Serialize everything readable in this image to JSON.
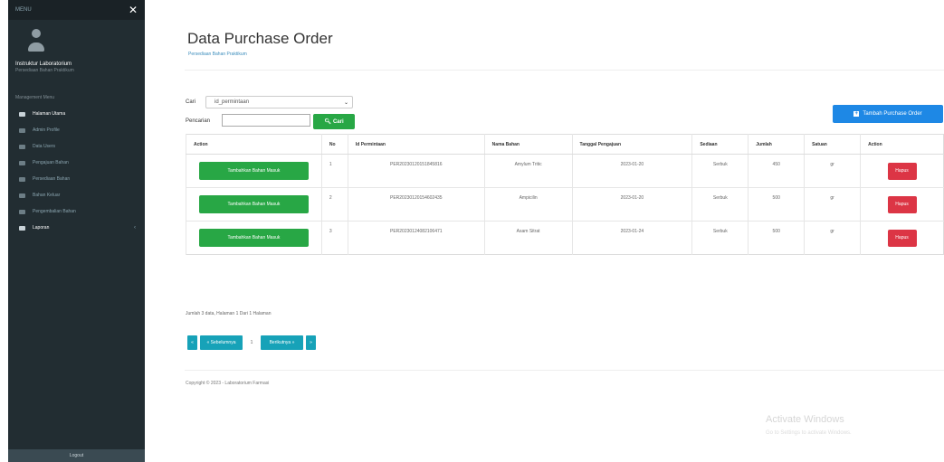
{
  "sidebar": {
    "header_label": "MENU",
    "user_name": "Instruktur Laboratorium",
    "user_role": "Persediaan Bahan Praktikum",
    "nav_header": "Management Menu",
    "items": [
      {
        "label": "Halaman Utama"
      },
      {
        "label": "Admin Profile"
      },
      {
        "label": "Data Users"
      },
      {
        "label": "Pengajuan Bahan"
      },
      {
        "label": "Persediaan Bahan"
      },
      {
        "label": "Bahan Keluar"
      },
      {
        "label": "Pengembalian Bahan"
      },
      {
        "label": "Laporan"
      }
    ],
    "bottom_label": "Logout"
  },
  "page": {
    "title": "Data Purchase Order",
    "subtitle": "Persediaan Bahan Praktikum"
  },
  "filters": {
    "cari_label": "Cari",
    "select_value": "id_permintaan",
    "pencarian_label": "Pencarian",
    "search_value": "",
    "cari_button": "Cari",
    "tambah_button": "Tambah Purchase Order"
  },
  "table": {
    "headers": [
      "Action",
      "No",
      "Id Permintaan",
      "Nama Bahan",
      "Tanggal Pengajuan",
      "Sediaan",
      "Jumlah",
      "Satuan",
      "Action"
    ],
    "rows": [
      {
        "action_label": "Tambahkan Bahan Masuk",
        "no": "1",
        "id": "PER20230120151845816",
        "nama": "Amylum Tritic",
        "tanggal": "2023-01-20",
        "sediaan": "Serbuk",
        "jumlah": "450",
        "satuan": "gr",
        "hapus": "Hapus"
      },
      {
        "action_label": "Tambahkan Bahan Masuk",
        "no": "2",
        "id": "PER20230120154602435",
        "nama": "Ampicilin",
        "tanggal": "2023-01-20",
        "sediaan": "Serbuk",
        "jumlah": "500",
        "satuan": "gr",
        "hapus": "Hapus"
      },
      {
        "action_label": "Tambahkan Bahan Masuk",
        "no": "3",
        "id": "PER20230124082106471",
        "nama": "Asam Sitrat",
        "tanggal": "2023-01-24",
        "sediaan": "Serbuk",
        "jumlah": "500",
        "satuan": "gr",
        "hapus": "Hapus"
      }
    ]
  },
  "pagination": {
    "summary": "Jumlah 3 data, Halaman 1 Dari 1 Halaman",
    "first": "«",
    "prev": "« Sebelumnya",
    "current": "1",
    "next": "Berikutnya »",
    "last": "»"
  },
  "footer": {
    "copyright": "Copyright © 2023 - Laboratorium Farmasi"
  },
  "watermark": {
    "line1": "Activate Windows",
    "line2": "Go to Settings to activate Windows."
  },
  "colors": {
    "sidebar_bg": "#222d32",
    "green": "#28a745",
    "red": "#dc3545",
    "blue": "#1e88e5",
    "teal": "#17a2b8"
  }
}
